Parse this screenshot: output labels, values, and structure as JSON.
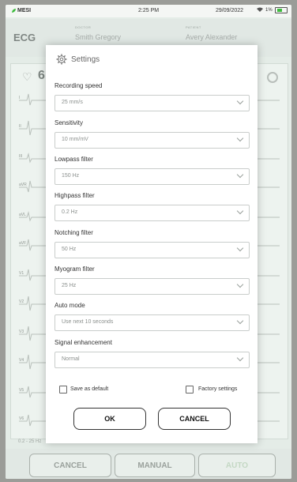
{
  "status": {
    "app": "MESI",
    "time": "2:25 PM",
    "date": "29/09/2022",
    "battery": "1%"
  },
  "header": {
    "title": "ECG",
    "doctor_label": "DOCTOR",
    "doctor": "Smith Gregory",
    "patient_label": "PATIENT",
    "patient": "Avery Alexander"
  },
  "monitor": {
    "heart_rate": "6",
    "leads": [
      "I",
      "II",
      "III",
      "aVR",
      "aVL",
      "aVF",
      "V1",
      "V2",
      "V3",
      "V4",
      "V5",
      "V6"
    ],
    "footnote": "0.2 - 25 Hz"
  },
  "bottom": {
    "cancel": "CANCEL",
    "manual": "MANUAL",
    "auto": "AUTO"
  },
  "dialog": {
    "title": "Settings",
    "fields": [
      {
        "label": "Recording speed",
        "value": "25 mm/s"
      },
      {
        "label": "Sensitivity",
        "value": "10 mm/mV"
      },
      {
        "label": "Lowpass filter",
        "value": "150 Hz"
      },
      {
        "label": "Highpass filter",
        "value": "0.2 Hz"
      },
      {
        "label": "Notching filter",
        "value": "50 Hz"
      },
      {
        "label": "Myogram filter",
        "value": "25 Hz"
      },
      {
        "label": "Auto mode",
        "value": "Use next 10 seconds"
      },
      {
        "label": "Signal enhancement",
        "value": "Normal"
      }
    ],
    "save_default": "Save as default",
    "factory": "Factory settings",
    "ok": "OK",
    "cancel": "CANCEL"
  },
  "colors": {
    "accent_green": "#3dbb3d",
    "overlay": "#9b9c98"
  }
}
